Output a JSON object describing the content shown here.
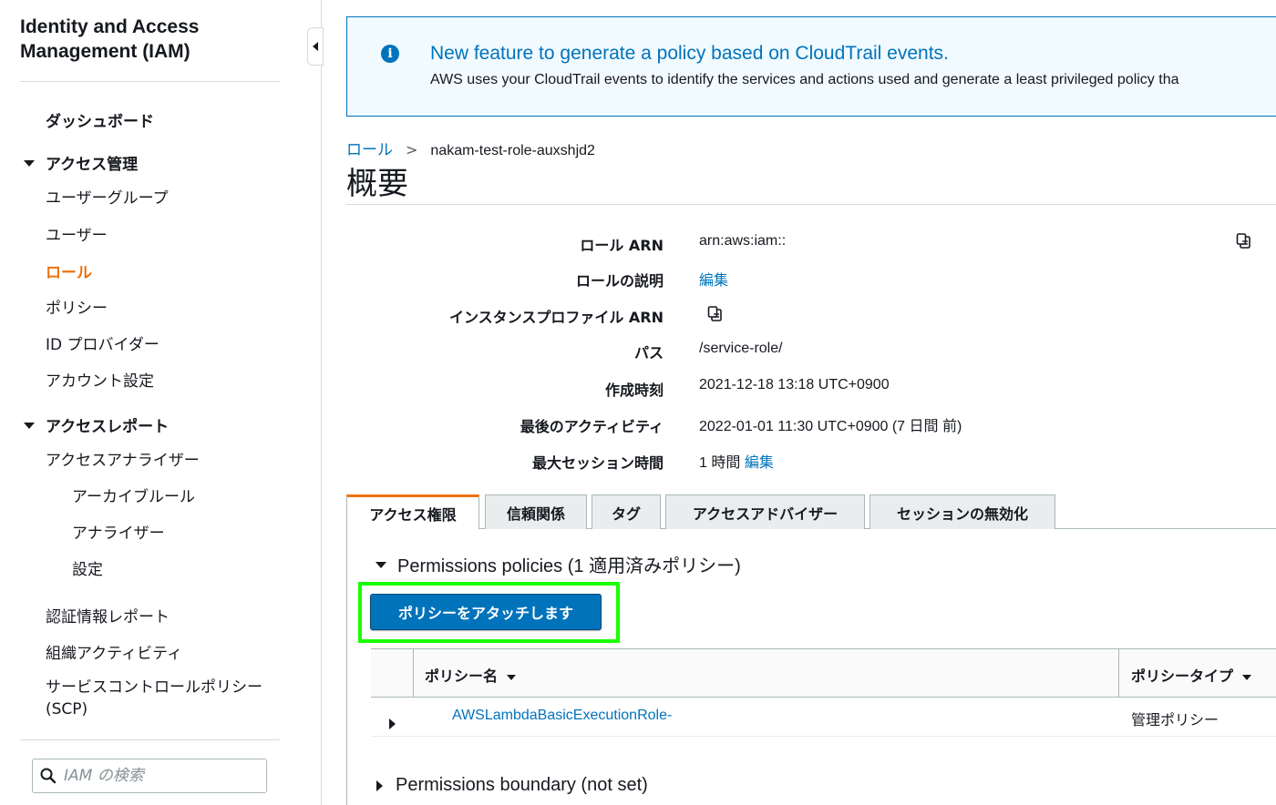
{
  "sidebar": {
    "title": "Identity and Access Management (IAM)",
    "dashboard": "ダッシュボード",
    "access_management": {
      "label": "アクセス管理",
      "items": [
        "ユーザーグループ",
        "ユーザー",
        "ロール",
        "ポリシー",
        "ID プロバイダー",
        "アカウント設定"
      ]
    },
    "access_reports": {
      "label": "アクセスレポート",
      "analyzer": "アクセスアナライザー",
      "analyzer_children": [
        "アーカイブルール",
        "アナライザー",
        "設定"
      ],
      "credential_report": "認証情報レポート",
      "org_activity": "組織アクティビティ",
      "scp": "サービスコントロールポリシー (SCP)"
    },
    "search_placeholder": "IAM の検索"
  },
  "banner": {
    "title": "New feature to generate a policy based on CloudTrail events.",
    "body": "AWS uses your CloudTrail events to identify the services and actions used and generate a least privileged policy tha"
  },
  "breadcrumb": {
    "parent": "ロール",
    "separator": ">",
    "current": "nakam-test-role-auxshjd2"
  },
  "page_title": "概要",
  "details": {
    "role_arn_label": "ロール ARN",
    "role_arn_value": "arn:aws:iam::",
    "description_label": "ロールの説明",
    "description_edit": "編集",
    "instance_profile_label": "インスタンスプロファイル ARN",
    "path_label": "パス",
    "path_value": "/service-role/",
    "created_label": "作成時刻",
    "created_value": "2021-12-18 13:18 UTC+0900",
    "last_activity_label": "最後のアクティビティ",
    "last_activity_value": "2022-01-01 11:30 UTC+0900 (7 日間 前)",
    "max_session_label": "最大セッション時間",
    "max_session_value": "1 時間",
    "max_session_edit": "編集"
  },
  "tabs": [
    "アクセス権限",
    "信頼関係",
    "タグ",
    "アクセスアドバイザー",
    "セッションの無効化"
  ],
  "permissions": {
    "section_title": "Permissions policies (1 適用済みポリシー)",
    "attach_button": "ポリシーをアタッチします",
    "columns": [
      "ポリシー名",
      "ポリシータイプ"
    ],
    "rows": [
      {
        "name": "AWSLambdaBasicExecutionRole-",
        "type": "管理ポリシー"
      }
    ],
    "boundary_title": "Permissions boundary (not set)"
  },
  "colors": {
    "accent_orange": "#ec7211",
    "link_blue": "#0073bb",
    "highlight_green": "#1aff00"
  }
}
